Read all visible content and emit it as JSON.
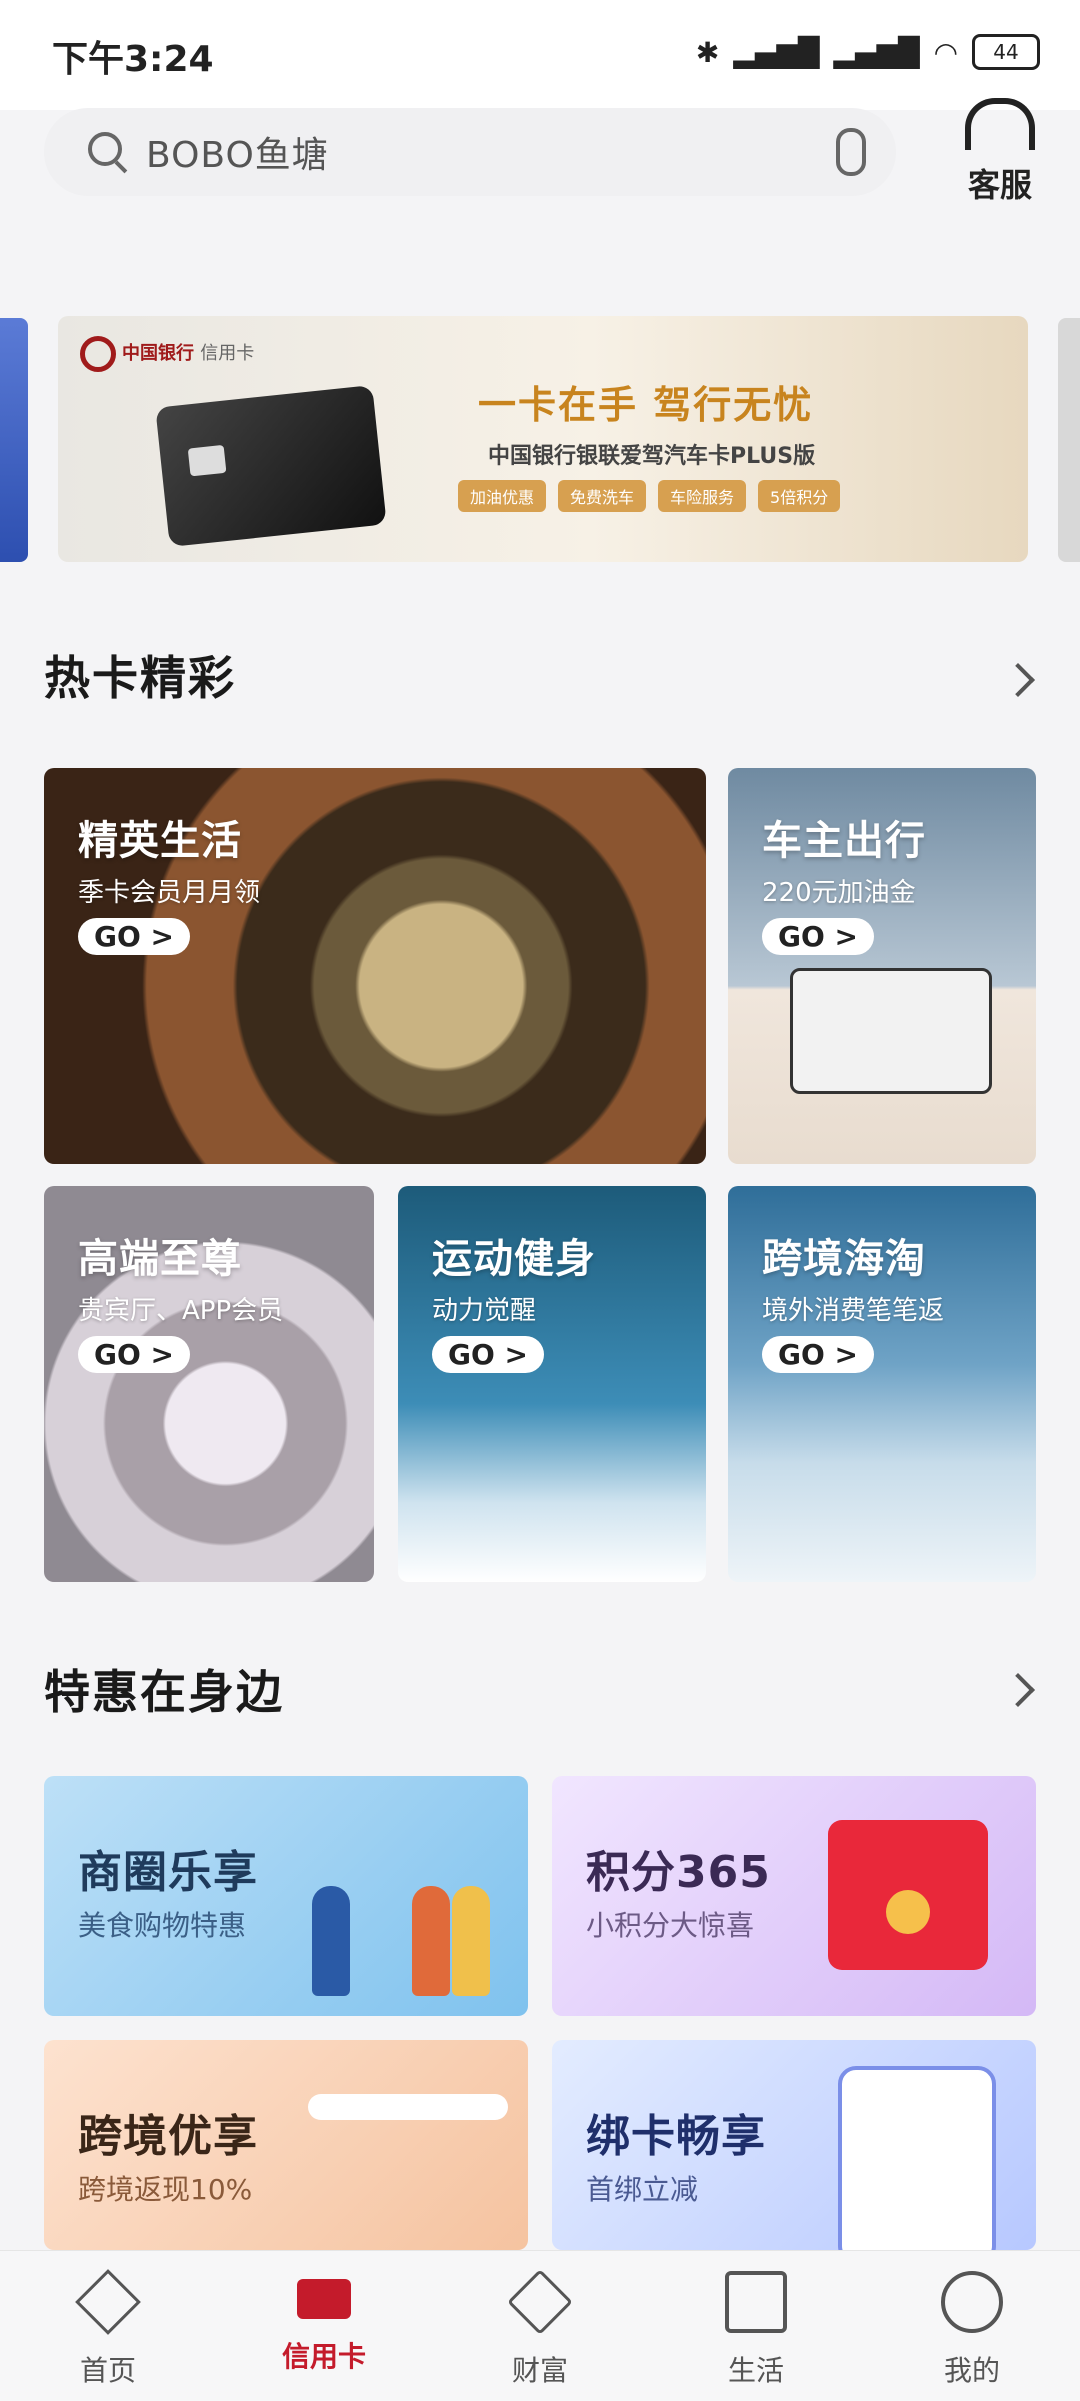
{
  "status": {
    "time": "下午3:24",
    "battery": "44"
  },
  "search": {
    "placeholder": "BOBO鱼塘"
  },
  "service": {
    "label": "客服"
  },
  "banner": {
    "bank_name": "中国银行",
    "card_type": "信用卡",
    "headline": "一卡在手 驾行无忧",
    "subtitle": "中国银行银联爱驾汽车卡PLUS版",
    "tags": [
      "加油优惠",
      "免费洗车",
      "车险服务",
      "5倍积分"
    ]
  },
  "hot": {
    "section_title": "热卡精彩",
    "cards": [
      {
        "title": "精英生活",
        "subtitle": "季卡会员月月领",
        "cta": "GO >"
      },
      {
        "title": "车主出行",
        "subtitle": "220元加油金",
        "cta": "GO >"
      },
      {
        "title": "高端至尊",
        "subtitle": "贵宾厅、APP会员",
        "cta": "GO >"
      },
      {
        "title": "运动健身",
        "subtitle": "动力觉醒",
        "cta": "GO >"
      },
      {
        "title": "跨境海淘",
        "subtitle": "境外消费笔笔返",
        "cta": "GO >"
      }
    ]
  },
  "offers": {
    "section_title": "特惠在身边",
    "items": [
      {
        "title": "商圈乐享",
        "subtitle": "美食购物特惠"
      },
      {
        "title": "积分365",
        "subtitle": "小积分大惊喜"
      },
      {
        "title": "跨境优享",
        "subtitle": "跨境返现10%"
      },
      {
        "title": "绑卡畅享",
        "subtitle": "首绑立减"
      }
    ]
  },
  "nav": {
    "items": [
      {
        "label": "首页",
        "icon": "diamond-icon"
      },
      {
        "label": "信用卡",
        "icon": "card-icon"
      },
      {
        "label": "财富",
        "icon": "wealth-icon"
      },
      {
        "label": "生活",
        "icon": "shopping-bag-icon"
      },
      {
        "label": "我的",
        "icon": "user-icon"
      }
    ],
    "active_color": "#c41b2b"
  }
}
